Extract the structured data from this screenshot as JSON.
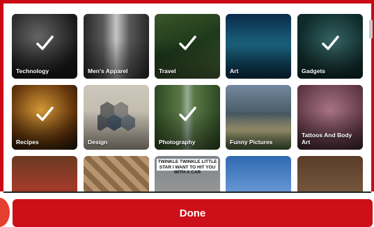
{
  "categories": [
    {
      "label": "Technology",
      "selected": true
    },
    {
      "label": "Men's Apparel",
      "selected": false
    },
    {
      "label": "Travel",
      "selected": true
    },
    {
      "label": "Art",
      "selected": false
    },
    {
      "label": "Gadgets",
      "selected": true
    },
    {
      "label": "Recipes",
      "selected": true
    },
    {
      "label": "Design",
      "selected": false
    },
    {
      "label": "Photography",
      "selected": true
    },
    {
      "label": "Funny Pictures",
      "selected": false
    },
    {
      "label": "Tattoos And Body Art",
      "selected": false
    }
  ],
  "partial_row": {
    "meme_caption": "TWINKLE TWINKLE LITTLE STAR I WANT TO HIT YOU WITH A CAR"
  },
  "done_label": "Done",
  "colors": {
    "brand_red": "#cc0f18"
  }
}
